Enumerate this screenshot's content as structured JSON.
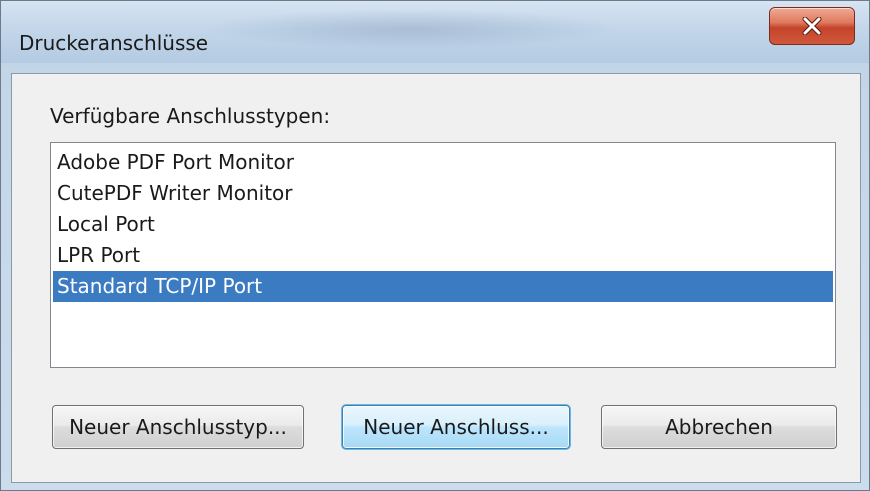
{
  "window": {
    "title": "Druckeranschlüsse",
    "close_icon": "close-x-icon"
  },
  "content": {
    "label": "Verfügbare Anschlusstypen:",
    "port_types": [
      {
        "label": "Adobe PDF Port Monitor",
        "selected": false
      },
      {
        "label": "CutePDF Writer Monitor",
        "selected": false
      },
      {
        "label": "Local Port",
        "selected": false
      },
      {
        "label": "LPR Port",
        "selected": false
      },
      {
        "label": "Standard TCP/IP Port",
        "selected": true
      }
    ]
  },
  "buttons": {
    "new_port_type": "Neuer Anschlusstyp...",
    "new_port": "Neuer Anschluss...",
    "cancel": "Abbrechen"
  },
  "colors": {
    "selection": "#3b7bc1",
    "close_button": "#c4442b"
  }
}
